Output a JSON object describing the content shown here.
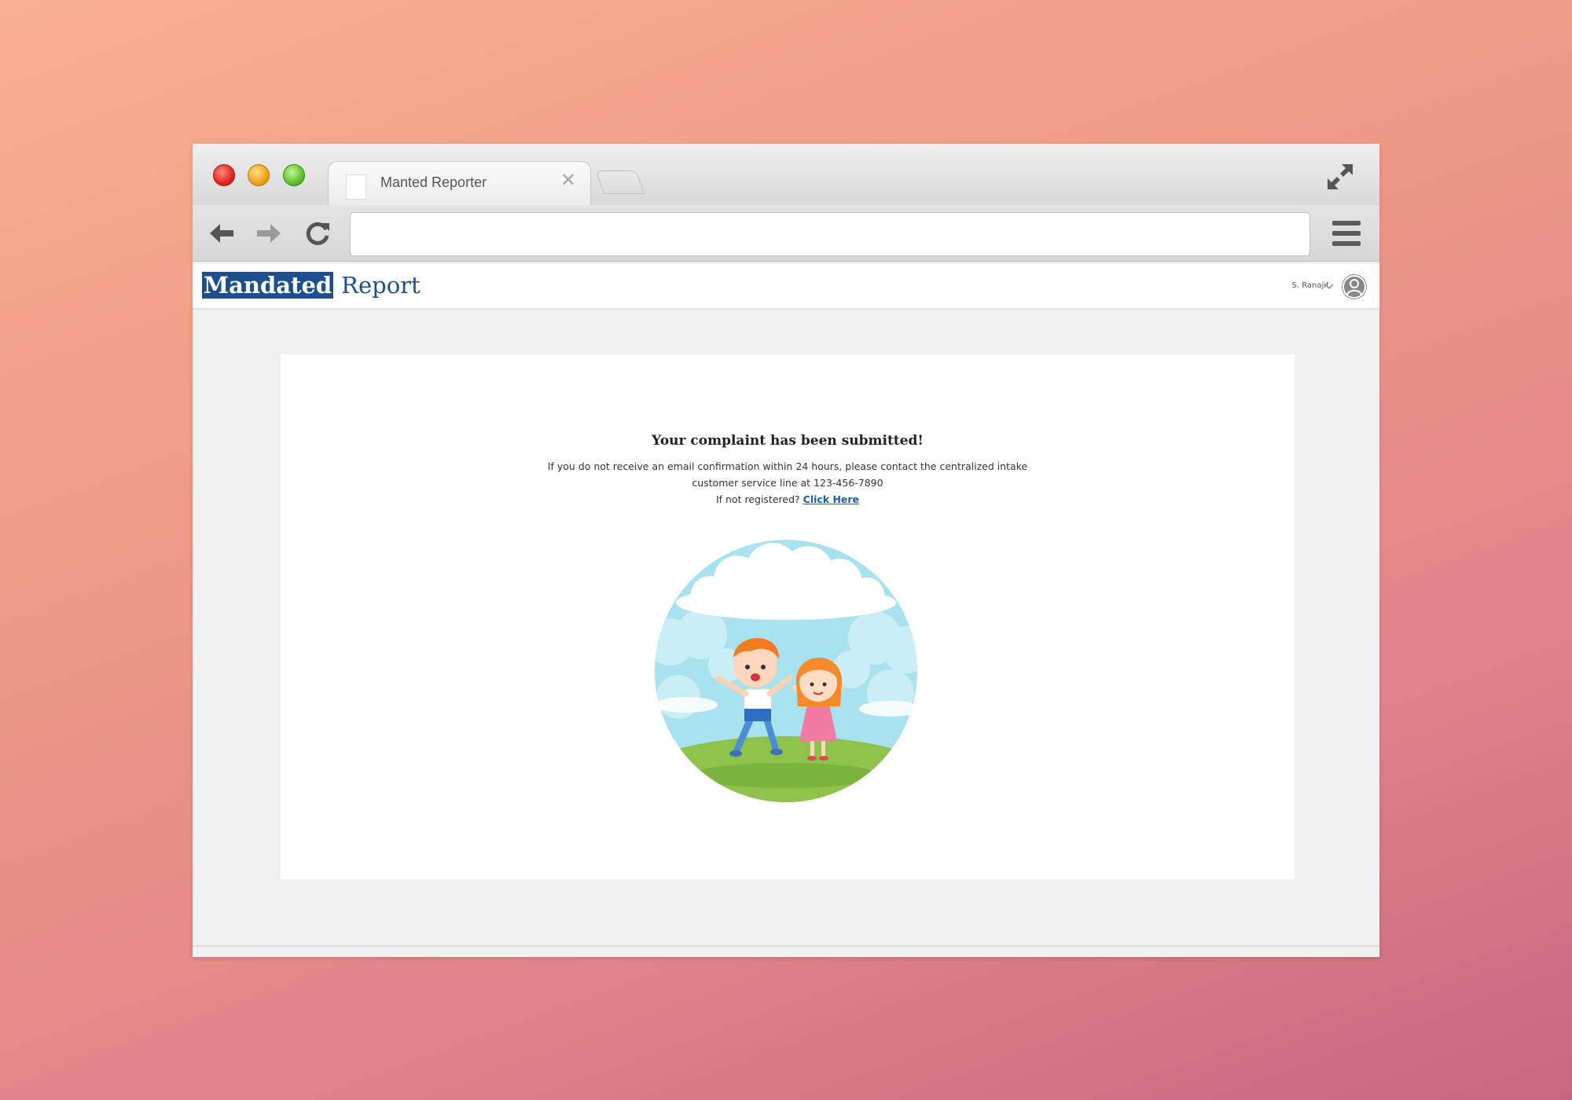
{
  "browser": {
    "tab_title": "Manted Reporter",
    "tab_close": "✕",
    "address_value": ""
  },
  "app": {
    "logo_highlight": "Mandated",
    "logo_rest": "Report",
    "user_name": "S. Ranajit"
  },
  "confirmation": {
    "heading": "Your complaint has been submitted!",
    "message_line1": "If you do not receive an email confirmation within 24 hours, please contact the centralized intake",
    "message_line2": "customer service line at 123-456-7890",
    "register_prompt": "If not registered?",
    "register_link": "Click Here"
  },
  "colors": {
    "brand_blue": "#1d4e8f",
    "link_blue": "#1a5fa8"
  }
}
